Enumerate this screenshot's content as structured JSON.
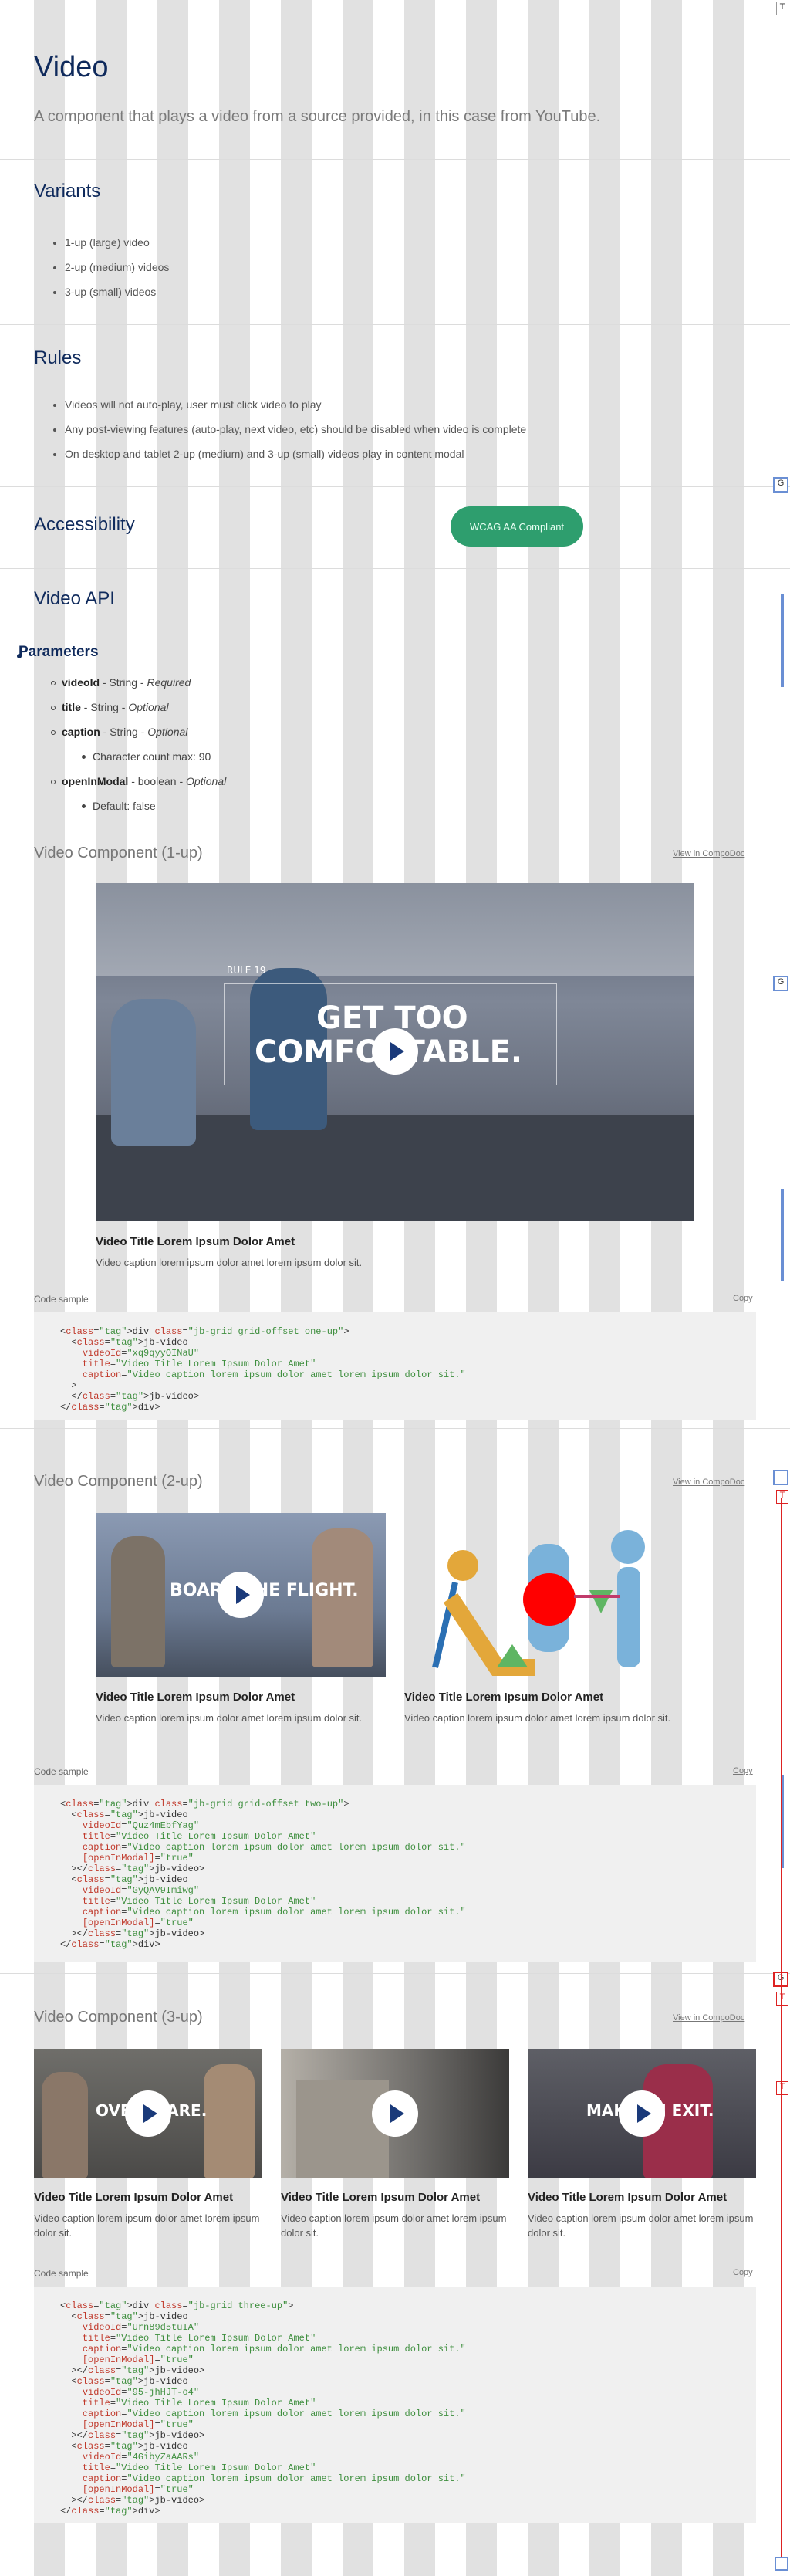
{
  "header": {
    "title": "Video",
    "subtitle": "A component that plays a video from a source provided, in this case from YouTube."
  },
  "variants": {
    "heading": "Variants",
    "items": [
      "1-up (large) video",
      "2-up (medium) videos",
      "3-up (small) videos"
    ]
  },
  "rules": {
    "heading": "Rules",
    "items": [
      "Videos will not auto-play, user must click video to play",
      "Any post-viewing features (auto-play, next video, etc) should be disabled when video is complete",
      "On desktop and tablet 2-up (medium) and 3-up (small) videos play in content modal"
    ]
  },
  "accessibility": {
    "heading": "Accessibility",
    "badge": "WCAG AA Compliant"
  },
  "api": {
    "heading": "Video API",
    "params_heading": "Parameters",
    "params": [
      {
        "name": "videoId",
        "type": " - String - ",
        "req": "Required"
      },
      {
        "name": "title",
        "type": " - String - ",
        "req": "Optional"
      },
      {
        "name": "caption",
        "type": " - String - ",
        "req": "Optional",
        "sub": "Character count max: 90"
      },
      {
        "name": "openInModal",
        "type": " - boolean - ",
        "req": "Optional",
        "sub": "Default: false"
      }
    ]
  },
  "common": {
    "view_link": "View in CompoDoc",
    "code_label": "Code sample",
    "copy": "Copy"
  },
  "one_up": {
    "heading": "Video Component (1-up)",
    "video": {
      "title": "Video Title Lorem Ipsum Dolor Amet",
      "caption": "Video caption lorem ipsum dolor amet lorem ipsum dolor sit.",
      "overlay1": "GET TOO",
      "overlay2": "COMFORTABLE.",
      "small": "RULE 19"
    }
  },
  "two_up": {
    "heading": "Video Component (2-up)",
    "videos": [
      {
        "title": "Video Title Lorem Ipsum Dolor Amet",
        "caption": "Video caption lorem ipsum dolor amet lorem ipsum dolor sit.",
        "overlay": "BOARD THE FLIGHT."
      },
      {
        "title": "Video Title Lorem Ipsum Dolor Amet",
        "caption": "Video caption lorem ipsum dolor amet lorem ipsum dolor sit."
      }
    ]
  },
  "three_up": {
    "heading": "Video Component (3-up)",
    "videos": [
      {
        "title": "Video Title Lorem Ipsum Dolor Amet",
        "caption": "Video caption lorem ipsum dolor amet lorem ipsum dolor sit.",
        "overlay": "OVERSHARE."
      },
      {
        "title": "Video Title Lorem Ipsum Dolor Amet",
        "caption": "Video caption lorem ipsum dolor amet lorem ipsum dolor sit."
      },
      {
        "title": "Video Title Lorem Ipsum Dolor Amet",
        "caption": "Video caption lorem ipsum dolor amet lorem ipsum dolor sit.",
        "overlay": "MAKE AN EXIT."
      }
    ]
  },
  "code": {
    "one_up": "<div class=\"jb-grid grid-offset one-up\">\n  <jb-video\n    videoId=\"xq9qyyOINaU\"\n    title=\"Video Title Lorem Ipsum Dolor Amet\"\n    caption=\"Video caption lorem ipsum dolor amet lorem ipsum dolor sit.\"\n  >\n  </jb-video>\n</div>",
    "two_up": "<div class=\"jb-grid grid-offset two-up\">\n  <jb-video\n    videoId=\"Quz4mEbfYag\"\n    title=\"Video Title Lorem Ipsum Dolor Amet\"\n    caption=\"Video caption lorem ipsum dolor amet lorem ipsum dolor sit.\"\n    [openInModal]=\"true\"\n  ></jb-video>\n  <jb-video\n    videoId=\"GyQAV9Imiwg\"\n    title=\"Video Title Lorem Ipsum Dolor Amet\"\n    caption=\"Video caption lorem ipsum dolor amet lorem ipsum dolor sit.\"\n    [openInModal]=\"true\"\n  ></jb-video>\n</div>",
    "three_up": "<div class=\"jb-grid three-up\">\n  <jb-video\n    videoId=\"Urn89d5tuIA\"\n    title=\"Video Title Lorem Ipsum Dolor Amet\"\n    caption=\"Video caption lorem ipsum dolor amet lorem ipsum dolor sit.\"\n    [openInModal]=\"true\"\n  ></jb-video>\n  <jb-video\n    videoId=\"95-jhHJT-o4\"\n    title=\"Video Title Lorem Ipsum Dolor Amet\"\n    caption=\"Video caption lorem ipsum dolor amet lorem ipsum dolor sit.\"\n    [openInModal]=\"true\"\n  ></jb-video>\n  <jb-video\n    videoId=\"4GibyZaAARs\"\n    title=\"Video Title Lorem Ipsum Dolor Amet\"\n    caption=\"Video caption lorem ipsum dolor amet lorem ipsum dolor sit.\"\n    [openInModal]=\"true\"\n  ></jb-video>\n</div>"
  },
  "rail": {
    "top": "T",
    "g": "G"
  },
  "colors": {
    "navy": "#0f2a5c",
    "badge": "#2e9e6e",
    "grid": "#c8c8c8"
  }
}
